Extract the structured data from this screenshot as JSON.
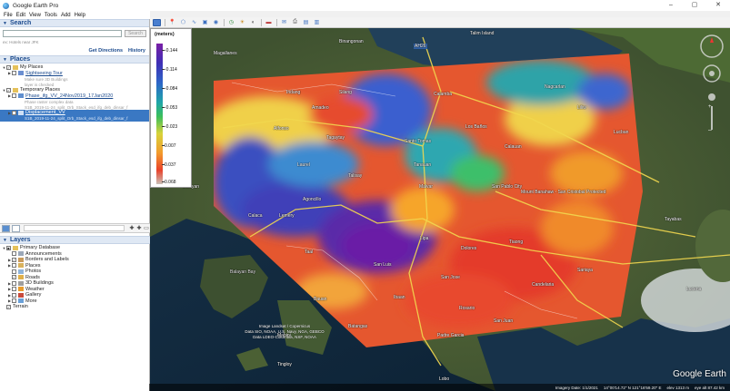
{
  "app": {
    "title": "Google Earth Pro"
  },
  "window_controls": {
    "minimize": "–",
    "maximize": "▢",
    "close": "✕"
  },
  "menu": [
    "File",
    "Edit",
    "View",
    "Tools",
    "Add",
    "Help"
  ],
  "search": {
    "header": "Search",
    "placeholder": "",
    "button": "Search",
    "hint": "ex: Hotels near JFK",
    "get_directions": "Get Directions",
    "history": "History"
  },
  "places": {
    "header": "Places",
    "rows": [
      {
        "label": "My Places",
        "level": 0
      },
      {
        "label": "Sightseeing Tour",
        "level": 1,
        "link": true
      },
      {
        "label": "Make sure 3D Buildings",
        "level": 2,
        "sub": true
      },
      {
        "label": "layer is checked",
        "level": 2,
        "sub": true
      },
      {
        "label": "Temporary Places",
        "level": 0
      },
      {
        "label": "Phase_ifg_VV_24Nov2019_17Jan2020",
        "level": 1,
        "link": true
      },
      {
        "label": "Phase raster complex data",
        "level": 2,
        "sub": true
      },
      {
        "label": "S1B_2019-11-24_split_Orb_Stack_esd_ifg_deb_dinsar_f",
        "level": 2,
        "sub": true
      },
      {
        "label": "Displacement_VV",
        "level": 1,
        "selected": true
      },
      {
        "label": "S1B_2019-11-24_split_Orb_Stack_esd_ifg_deb_dinsar_f",
        "level": 2,
        "sub": true,
        "selected": true
      }
    ]
  },
  "layers": {
    "header": "Layers",
    "rows": [
      {
        "label": "Primary Database",
        "level": 0
      },
      {
        "label": "Announcements",
        "level": 1
      },
      {
        "label": "Borders and Labels",
        "level": 1
      },
      {
        "label": "Places",
        "level": 1
      },
      {
        "label": "Photos",
        "level": 1
      },
      {
        "label": "Roads",
        "level": 1
      },
      {
        "label": "3D Buildings",
        "level": 1
      },
      {
        "label": "Weather",
        "level": 1
      },
      {
        "label": "Gallery",
        "level": 1
      },
      {
        "label": "More",
        "level": 1
      },
      {
        "label": "Terrain",
        "level": 0
      }
    ]
  },
  "legend": {
    "unit": "(meters)",
    "ticks": [
      "-0.144",
      "-0.114",
      "-0.084",
      "-0.053",
      "-0.023",
      "0.007",
      "0.037",
      "0.068"
    ]
  },
  "map_labels": {
    "talim_island": "Talim Island",
    "binangonan": "Binangonan",
    "magallanes": "Magallanes",
    "silang": "Silang",
    "calamba": "Calamba",
    "amadeo": "Amadeo",
    "indang": "Indang",
    "alfonso": "Alfonso",
    "tagaytay": "Tagaytay",
    "santo_tomas": "Santo Tomas",
    "los_banos": "Los Baños",
    "tanauan": "Tanauan",
    "calauan": "Calauan",
    "nagcarlan": "Nagcarlan",
    "liliw": "Liliw",
    "talisay": "Talisay",
    "laurel": "Laurel",
    "malvar": "Malvar",
    "san_pablo": "San Pablo City",
    "mount_banahaw": "Mount Banahaw - San Cristobal Protected",
    "lucban": "Lucban",
    "tayabas": "Tayabas",
    "balayan": "Balayan",
    "calaca": "Calaca",
    "lemery": "Lemery",
    "agoncillo": "Agoncillo",
    "lipa": "Lipa",
    "taal": "Taal",
    "san_luis": "San Luis",
    "tiaong": "Tiaong",
    "san_jose": "San Jose",
    "dolores": "Dolores",
    "candelaria": "Candelaria",
    "sariaya": "Sariaya",
    "lucena": "Lucena",
    "balayan_bay": "Balayan Bay",
    "bauan": "Bauan",
    "ibaan": "Ibaan",
    "rosario": "Rosario",
    "mabini": "Mabini",
    "batangas": "Batangas",
    "padre_garcia": "Padre Garcia",
    "san_juan": "San Juan",
    "tingloy": "Tingloy",
    "lobo": "Lobo",
    "ah26": "AH26"
  },
  "copyright": "Image Landsat / Copernicus\nData SIO, NOAA, U.S. Navy, NGA, GEBCO\nData LDEO-Columbia, NSF, NOAA",
  "status": {
    "imagery_date": "Imagery Date: 1/1/2021",
    "coords": "14°00'14.72\" N   121°16'59.20\" E",
    "elevation": "elev 1313 m",
    "eye_alt": "eye alt 87.42 km"
  },
  "brand": "Google Earth"
}
